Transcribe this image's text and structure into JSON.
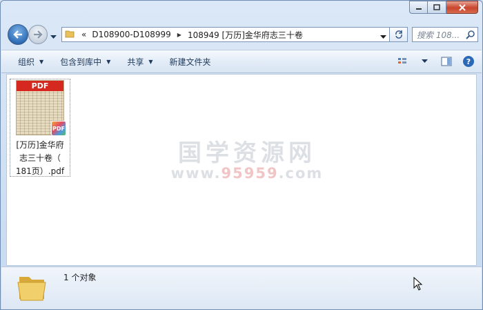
{
  "window": {
    "address": {
      "overflow": "«",
      "crumbs": [
        "D108900-D108999",
        "108949 [万历]金华府志三十卷"
      ]
    },
    "search": {
      "placeholder": "搜索 108..."
    }
  },
  "toolbar": {
    "organize": "组织",
    "include_library": "包含到库中",
    "share": "共享",
    "new_folder": "新建文件夹"
  },
  "file": {
    "thumb_label": "PDF",
    "badge": "PDF",
    "name_line1": "[万历]金华府",
    "name_line2": "志三十卷（",
    "name_line3": "181页）.pdf"
  },
  "watermark": {
    "line1": "国学资源网",
    "line2_a": "www.",
    "line2_b": "95959",
    "line2_c": ".com"
  },
  "status": {
    "count_text": "1 个对象"
  },
  "colors": {
    "accent": "#2f6db5",
    "pdf_red": "#d5281e"
  }
}
